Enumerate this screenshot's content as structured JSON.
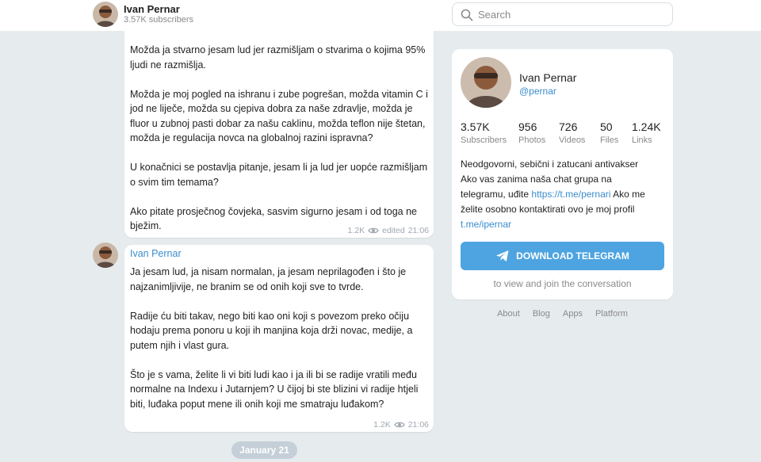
{
  "header": {
    "channel_name": "Ivan Pernar",
    "subscribers": "3.57K subscribers"
  },
  "search": {
    "placeholder": "Search"
  },
  "messages": [
    {
      "paragraphs": [
        "Možda ja stvarno jesam lud jer razmišljam o stvarima o kojima 95% ljudi ne razmišlja.",
        "Možda je moj pogled na ishranu i zube pogrešan, možda vitamin C i jod ne liječe, možda su cjepiva dobra za naše zdravlje, možda je fluor u zubnoj pasti dobar za našu caklinu, možda teflon nije štetan, možda je regulacija novca na globalnoj razini ispravna?",
        "U konačnici se postavlja pitanje, jesam li ja lud jer uopće razmišljam o svim tim temama?",
        "Ako pitate prosječnog čovjeka, sasvim sigurno jesam i od toga ne bježim."
      ],
      "views": "1.2K",
      "edited": "edited",
      "time": "21:06"
    },
    {
      "author": "Ivan Pernar",
      "paragraphs": [
        "Ja jesam lud, ja nisam normalan, ja jesam neprilagođen i što je najzanimljivije, ne branim se od onih koji sve to tvrde.",
        "Radije ću biti takav, nego biti kao oni koji s povezom preko očiju hodaju prema ponoru u koji ih manjina koja drži novac, medije, a putem njih i vlast gura.",
        "Što je s vama, želite li vi biti ludi kao i ja ili bi se radije vratili među normalne na Indexu i Jutarnjem? U čijoj bi ste blizini vi radije htjeli biti, luđaka poput mene ili onih koji me smatraju luđakom?"
      ],
      "views": "1.2K",
      "time": "21:06"
    }
  ],
  "date_separator": "January 21",
  "card": {
    "name": "Ivan Pernar",
    "handle": "@pernar",
    "stats": [
      {
        "value": "3.57K",
        "label": "Subscribers"
      },
      {
        "value": "956",
        "label": "Photos"
      },
      {
        "value": "726",
        "label": "Videos"
      },
      {
        "value": "50",
        "label": "Files"
      },
      {
        "value": "1.24K",
        "label": "Links"
      }
    ],
    "description_line1": "Neodgovorni, sebični i zatucani antivakser",
    "description_line2": "Ako vas zanima naša chat grupa na",
    "description_line3_pre": "telegramu, uđite ",
    "description_link1": "https://t.me/pernari",
    "description_line3_post": " Ako me",
    "description_line4": "želite osobno kontaktirati ovo je moj profil",
    "description_link2": "t.me/ipernar",
    "download_label": "DOWNLOAD TELEGRAM",
    "join_text": "to view and join the conversation"
  },
  "footer": [
    "About",
    "Blog",
    "Apps",
    "Platform"
  ],
  "colors": {
    "accent": "#3a8ccc",
    "button": "#4ea4e0",
    "background": "#e6ebee"
  }
}
